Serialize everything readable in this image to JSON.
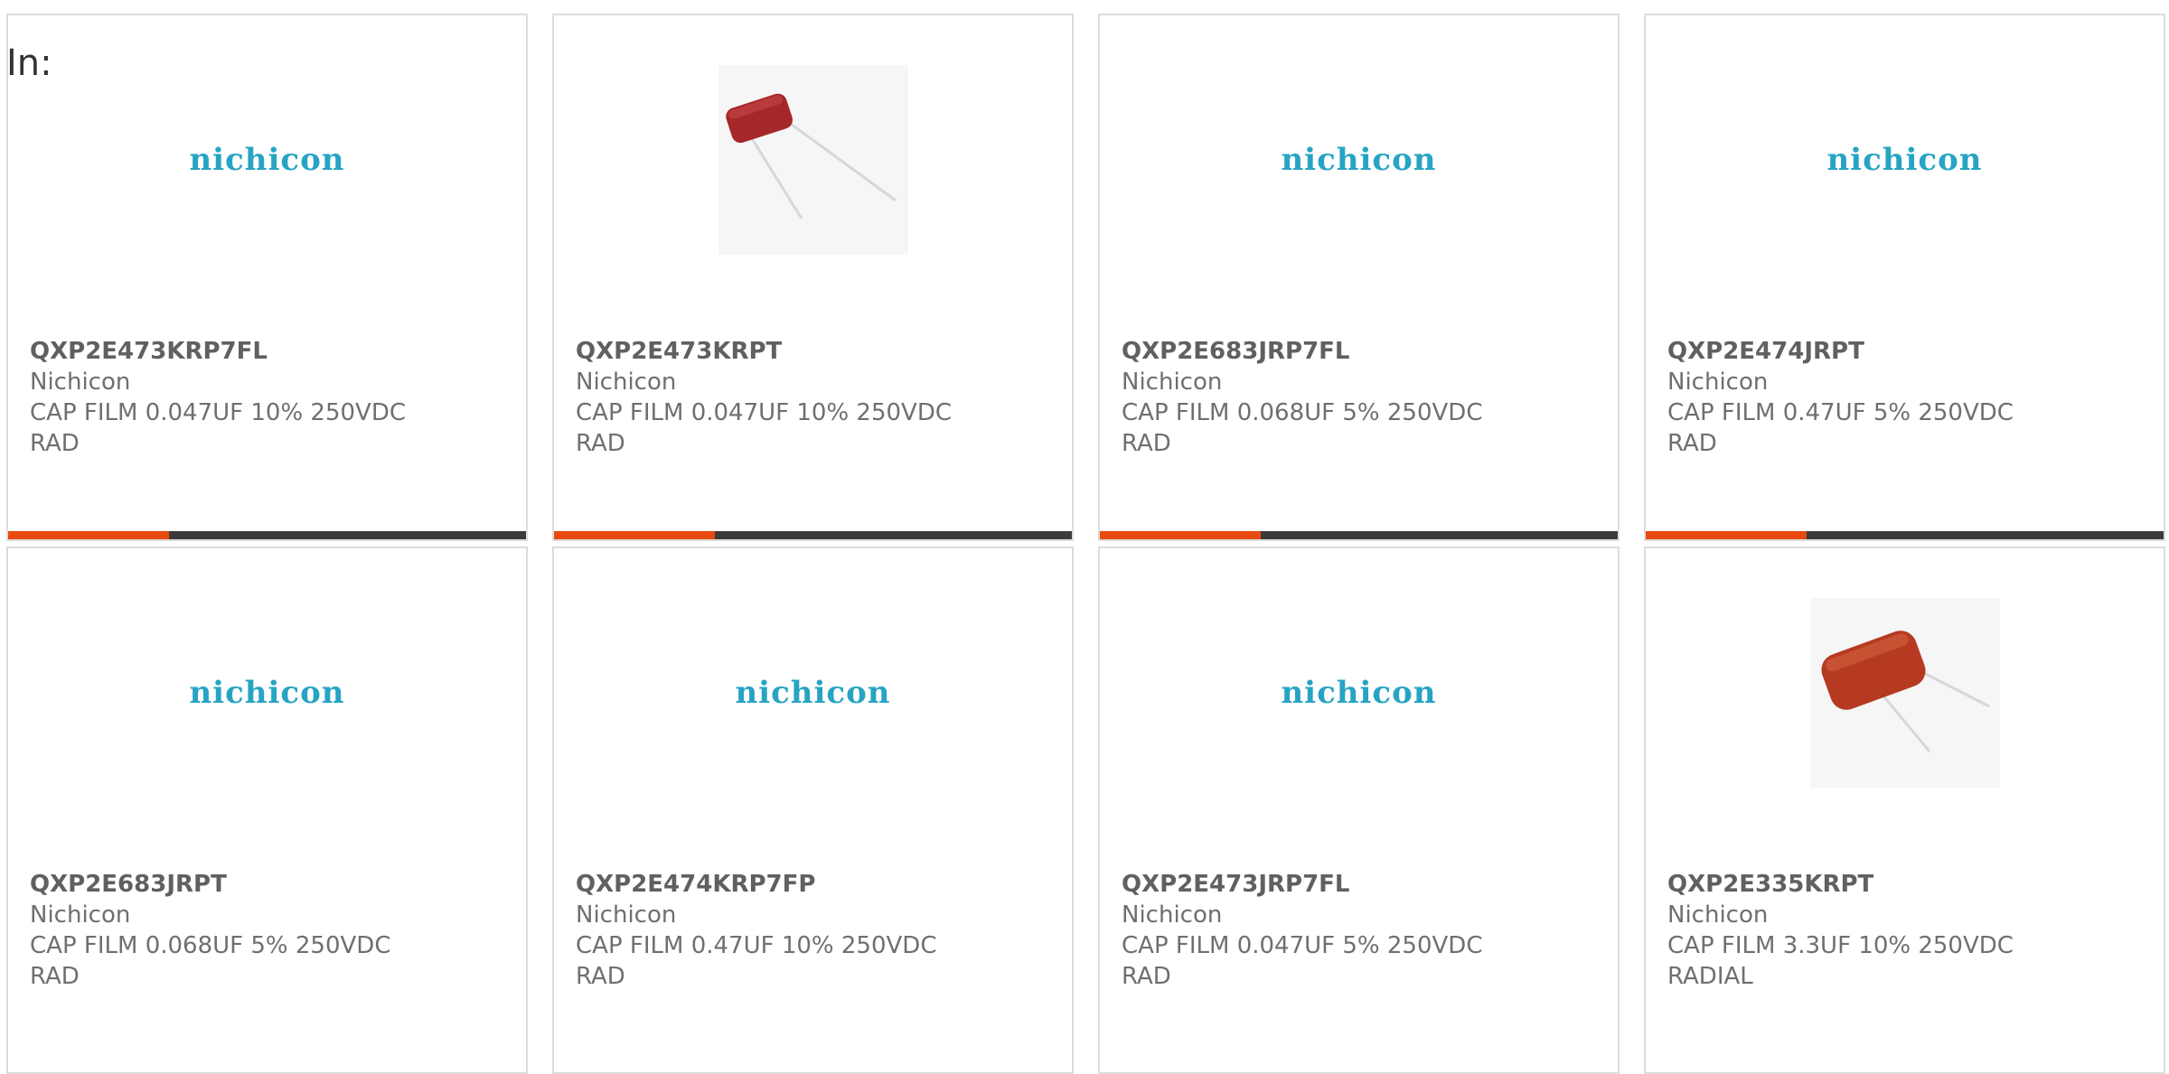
{
  "filter": {
    "label": "In:"
  },
  "colors": {
    "logo": "#27a4c4",
    "accent": "#e84a10",
    "bar": "#3b3b3b",
    "border": "#dcdcdc"
  },
  "products": [
    {
      "part_number": "QXP2E473KRP7FL",
      "manufacturer": "Nichicon",
      "description": "CAP FILM 0.047UF 10% 250VDC RAD",
      "image": "nichicon-logo",
      "logo_text": "nichicon",
      "accent_fraction": 0.31
    },
    {
      "part_number": "QXP2E473KRPT",
      "manufacturer": "Nichicon",
      "description": "CAP FILM 0.047UF 10% 250VDC RAD",
      "image": "capacitor-photo",
      "accent_fraction": 0.31
    },
    {
      "part_number": "QXP2E683JRP7FL",
      "manufacturer": "Nichicon",
      "description": "CAP FILM 0.068UF 5% 250VDC RAD",
      "image": "nichicon-logo",
      "logo_text": "nichicon",
      "accent_fraction": 0.31
    },
    {
      "part_number": "QXP2E474JRPT",
      "manufacturer": "Nichicon",
      "description": "CAP FILM 0.47UF 5% 250VDC RAD",
      "image": "nichicon-logo",
      "logo_text": "nichicon",
      "accent_fraction": 0.31
    },
    {
      "part_number": "QXP2E683JRPT",
      "manufacturer": "Nichicon",
      "description": "CAP FILM 0.068UF 5% 250VDC RAD",
      "image": "nichicon-logo",
      "logo_text": "nichicon"
    },
    {
      "part_number": "QXP2E474KRP7FP",
      "manufacturer": "Nichicon",
      "description": "CAP FILM 0.47UF 10% 250VDC RAD",
      "image": "nichicon-logo",
      "logo_text": "nichicon"
    },
    {
      "part_number": "QXP2E473JRP7FL",
      "manufacturer": "Nichicon",
      "description": "CAP FILM 0.047UF 5% 250VDC RAD",
      "image": "nichicon-logo",
      "logo_text": "nichicon"
    },
    {
      "part_number": "QXP2E335KRPT",
      "manufacturer": "Nichicon",
      "description": "CAP FILM 3.3UF 10% 250VDC RADIAL",
      "image": "capacitor-photo"
    }
  ]
}
